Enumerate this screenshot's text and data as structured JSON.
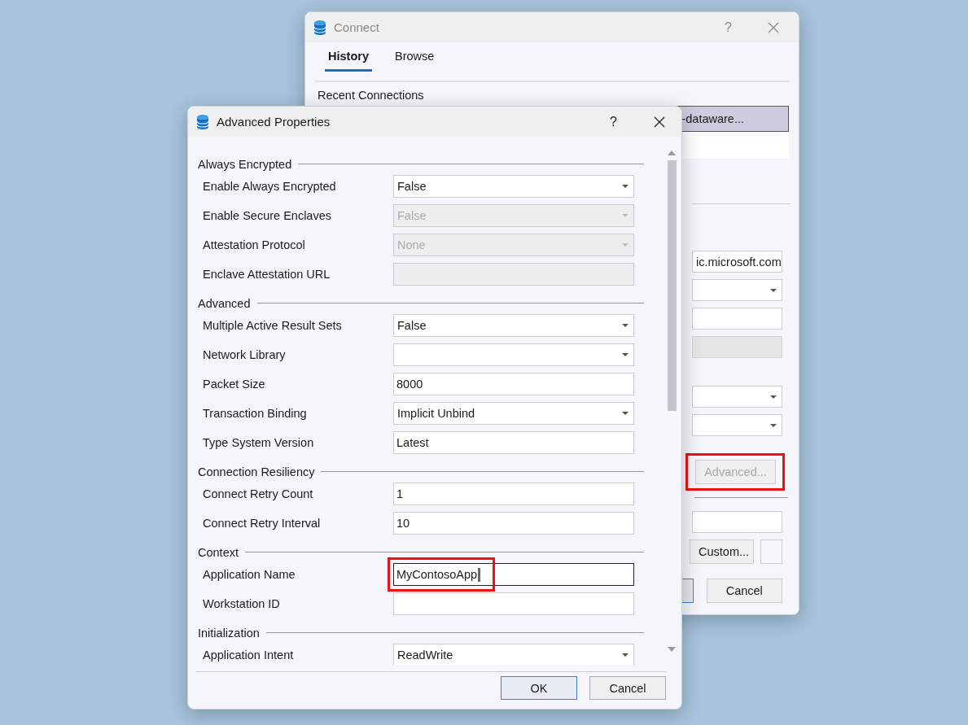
{
  "background_window": {
    "title": "Connect",
    "help": "?",
    "tabs": [
      {
        "label": "History",
        "selected": true
      },
      {
        "label": "Browse",
        "selected": false
      }
    ],
    "section_label": "Recent Connections",
    "recent_connections": [
      {
        "text": "-dataware...",
        "selected": true
      }
    ],
    "fields": [
      {
        "kind": "text",
        "value": "ic.microsoft.com",
        "disabled": false
      },
      {
        "kind": "dropdown",
        "disabled": false
      },
      {
        "kind": "text",
        "disabled": false
      },
      {
        "kind": "text",
        "disabled": true
      },
      {
        "kind": "dropdown",
        "disabled": false
      },
      {
        "kind": "dropdown",
        "disabled": false
      }
    ],
    "advanced_button": {
      "label": "Advanced...",
      "disabled": true,
      "highlighted": true
    },
    "custom_button": {
      "label": "Custom..."
    },
    "buttons": [
      {
        "label": "Cancel"
      }
    ]
  },
  "dialog": {
    "title": "Advanced Properties",
    "help": "?",
    "groups": [
      {
        "title": "Always Encrypted",
        "rows": [
          {
            "label": "Enable Always Encrypted",
            "kind": "dropdown",
            "value": "False",
            "disabled": false,
            "focused": false
          },
          {
            "label": "Enable Secure Enclaves",
            "kind": "dropdown",
            "value": "False",
            "disabled": true,
            "focused": false
          },
          {
            "label": "Attestation Protocol",
            "kind": "dropdown",
            "value": "None",
            "disabled": true,
            "focused": false
          },
          {
            "label": "Enclave Attestation URL",
            "kind": "text",
            "disabled": true,
            "focused": false
          }
        ]
      },
      {
        "title": "Advanced",
        "rows": [
          {
            "label": "Multiple Active Result Sets",
            "kind": "dropdown",
            "value": "False",
            "disabled": false,
            "focused": false
          },
          {
            "label": "Network Library",
            "kind": "dropdown",
            "disabled": false,
            "focused": false
          },
          {
            "label": "Packet Size",
            "kind": "text",
            "value": "8000",
            "disabled": false,
            "focused": false
          },
          {
            "label": "Transaction Binding",
            "kind": "dropdown",
            "value": "Implicit Unbind",
            "disabled": false,
            "focused": false
          },
          {
            "label": "Type System Version",
            "kind": "text",
            "value": "Latest",
            "disabled": false,
            "focused": false
          }
        ]
      },
      {
        "title": "Connection Resiliency",
        "rows": [
          {
            "label": "Connect Retry Count",
            "kind": "text",
            "value": "1",
            "disabled": false,
            "focused": false
          },
          {
            "label": "Connect Retry Interval",
            "kind": "text",
            "value": "10",
            "disabled": false,
            "focused": false
          }
        ]
      },
      {
        "title": "Context",
        "rows": [
          {
            "label": "Application Name",
            "kind": "text",
            "value": "MyContosoApp",
            "disabled": false,
            "focused": true,
            "highlighted": true
          },
          {
            "label": "Workstation ID",
            "kind": "text",
            "disabled": false,
            "focused": false
          }
        ]
      },
      {
        "title": "Initialization",
        "rows": [
          {
            "label": "Application Intent",
            "kind": "dropdown",
            "value": "ReadWrite",
            "disabled": false,
            "focused": false
          }
        ]
      }
    ],
    "buttons": [
      {
        "label": "OK",
        "default": true
      },
      {
        "label": "Cancel",
        "default": false
      }
    ]
  }
}
